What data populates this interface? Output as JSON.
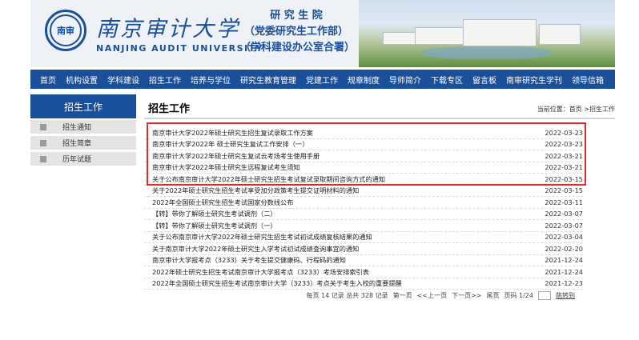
{
  "header": {
    "logo_char": "南审",
    "university_cn": "南京审计大学",
    "university_en": "NANJING AUDIT UNIVERSITY",
    "dept_lines": [
      "研 究 生 院",
      "（党委研究生工作部）",
      "（学科建设办公室合署）"
    ]
  },
  "nav": [
    "首页",
    "机构设置",
    "学科建设",
    "招生工作",
    "培养与学位",
    "研究生教育管理",
    "党建工作",
    "规章制度",
    "导师简介",
    "下载专区",
    "留言板",
    "南审研究生学刊",
    "领导信箱"
  ],
  "sidebar": {
    "title": "招生工作",
    "items": [
      "招生通知",
      "招生简章",
      "历年试题"
    ]
  },
  "content": {
    "title": "招生工作",
    "location": "当前位置：首页 >招生工作"
  },
  "news": [
    {
      "title": "南京审计大学2022年硕士研究生招生复试录取工作方案",
      "date": "2022-03-23"
    },
    {
      "title": "南京审计大学2022年 硕士研究生复试工作安排（一）",
      "date": "2022-03-23"
    },
    {
      "title": "南京审计大学2022年硕士研究生复试云考场考生使用手册",
      "date": "2022-03-21"
    },
    {
      "title": "南京审计大学2022年硕士研究生远程复试考生须知",
      "date": "2022-03-21"
    },
    {
      "title": "关于公布南京审计大学2022年硕士研究生招生考试复试录取期间咨询方式的通知",
      "date": "2022-03-15"
    },
    {
      "title": "关于2022年硕士研究生招生考试享受加分政策考生提交证明材料的通知",
      "date": "2022-03-15"
    },
    {
      "title": "2022年全国硕士研究生招生考试国家分数线公布",
      "date": "2022-03-11"
    },
    {
      "title": "【转】带你了解硕士研究生考试调剂（二）",
      "date": "2022-03-07"
    },
    {
      "title": "【转】带你了解硕士研究生考试调剂（一）",
      "date": "2022-03-07"
    },
    {
      "title": "关于公布南京审计大学2022年硕士研究生招生考试初试成绩复核结果的通知",
      "date": "2022-03-04"
    },
    {
      "title": "关于南京审计大学2022年硕士研究生入学考试初试成绩查询事宜的通知",
      "date": "2022-02-20"
    },
    {
      "title": "南京审计大学报考点（3233）关于考生提交健康码、行程码的通知",
      "date": "2021-12-24"
    },
    {
      "title": "2022年硕士研究生招生考试南京审计大学报考点（3233）考场安排索引表",
      "date": "2021-12-24"
    },
    {
      "title": "2022年全国硕士研究生招生考试南京审计大学（3233）考点关于考生入校的重要提醒",
      "date": "2021-12-23"
    }
  ],
  "pager": {
    "summary": "每页 14 记录  总共 328 记录",
    "first": "第一页",
    "prev": "<<上一页",
    "next": "下一页>>",
    "last": "尾页",
    "page": "页码 1/24",
    "go": "跳转到"
  },
  "colors": {
    "brand": "#1a4f9a",
    "highlight": "#e32a2a"
  }
}
